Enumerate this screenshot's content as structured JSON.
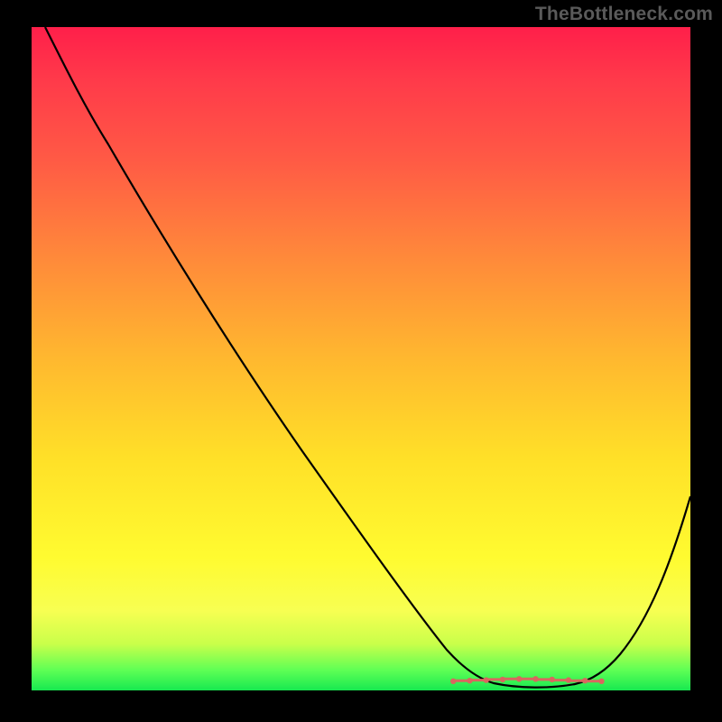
{
  "watermark": "TheBottleneck.com",
  "colors": {
    "frame_bg": "#000000",
    "watermark_text": "#5a5a5a",
    "curve": "#000000",
    "bottom_tick": "#d9675f"
  },
  "chart_data": {
    "type": "line",
    "title": "",
    "xlabel": "",
    "ylabel": "",
    "xlim": [
      0,
      100
    ],
    "ylim": [
      0,
      100
    ],
    "series": [
      {
        "name": "curve",
        "x": [
          2,
          10,
          20,
          30,
          40,
          50,
          60,
          66,
          70,
          74,
          78,
          82,
          86,
          90,
          94,
          100
        ],
        "y": [
          100,
          89,
          76,
          62,
          48,
          34,
          20,
          10,
          5,
          2,
          0.8,
          0.5,
          1,
          4,
          12,
          30
        ]
      }
    ],
    "bottom_markers_x": [
      64,
      66.5,
      69,
      71.5,
      74,
      76.5,
      79,
      81.5,
      84,
      86.5
    ],
    "gradient_stops": [
      {
        "pct": 0,
        "color": "#ff1f4a"
      },
      {
        "pct": 8,
        "color": "#ff3a4a"
      },
      {
        "pct": 20,
        "color": "#ff5a45"
      },
      {
        "pct": 35,
        "color": "#ff8a3a"
      },
      {
        "pct": 50,
        "color": "#ffb82f"
      },
      {
        "pct": 65,
        "color": "#ffe028"
      },
      {
        "pct": 80,
        "color": "#fffb30"
      },
      {
        "pct": 88,
        "color": "#f7ff52"
      },
      {
        "pct": 93,
        "color": "#c9ff4a"
      },
      {
        "pct": 97,
        "color": "#5dff55"
      },
      {
        "pct": 100,
        "color": "#17e850"
      }
    ]
  }
}
